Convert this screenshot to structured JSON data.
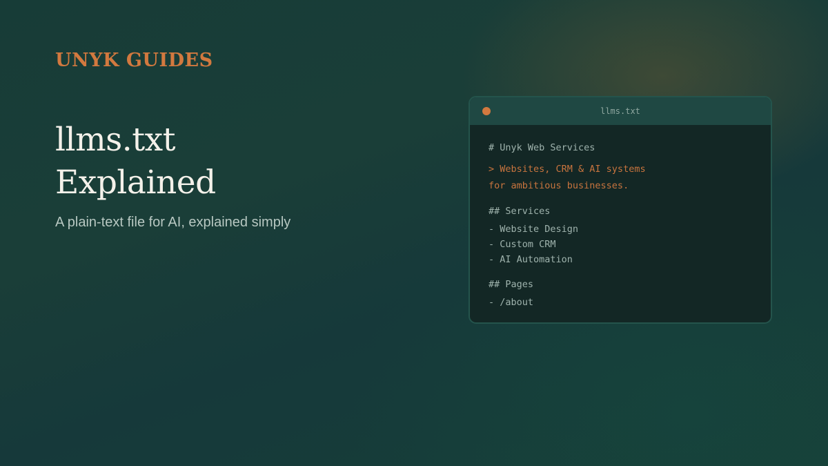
{
  "brand": "UNYK GUIDES",
  "title": {
    "line1": "llms.txt",
    "line2": "Explained"
  },
  "subtitle": "A plain-text file for AI, explained simply",
  "file_window": {
    "filename": "llms.txt",
    "lines": {
      "heading": "# Unyk Web Services",
      "quote1": "> Websites, CRM & AI systems",
      "quote2": "for ambitious businesses.",
      "services_heading": "## Services",
      "service1": "- Website Design",
      "service2": "- Custom CRM",
      "service3": "- AI Automation",
      "pages_heading": "## Pages",
      "page1": "- /about"
    }
  },
  "colors": {
    "accent": "#d2793f",
    "background": "#173c37",
    "window_titlebar": "#1f4843",
    "window_body": "#132725"
  },
  "icons": {
    "window_dot": "orange-dot-icon"
  }
}
